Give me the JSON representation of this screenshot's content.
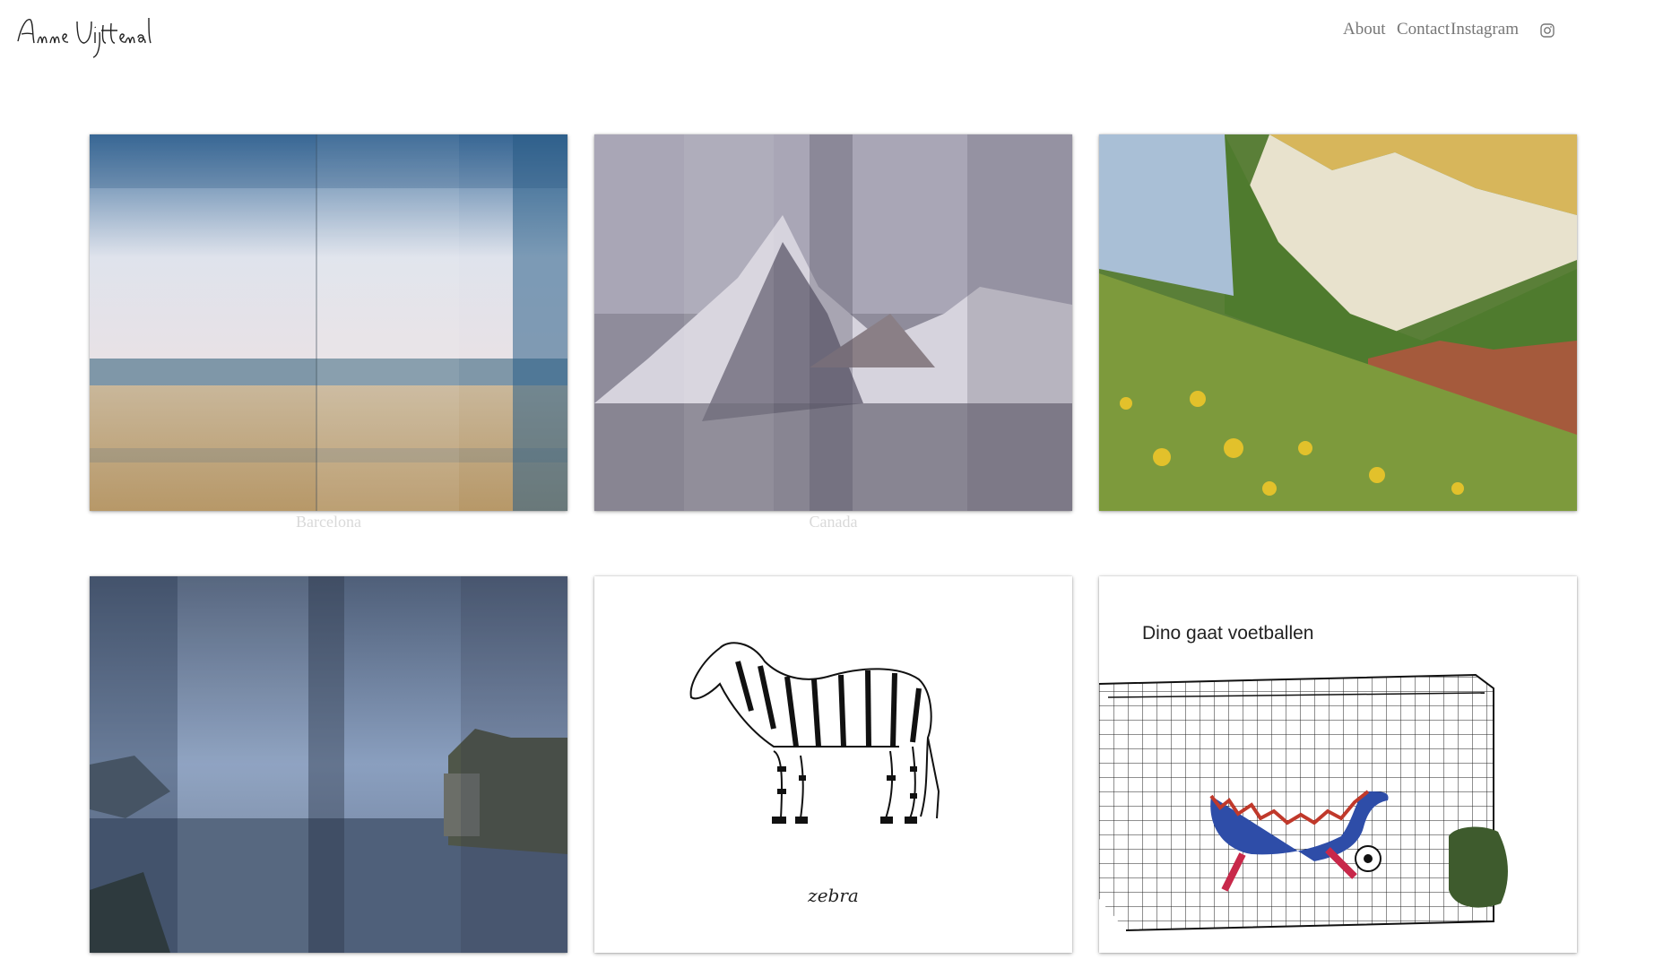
{
  "header": {
    "logo_text": "Anne Uijttewaal",
    "nav": {
      "about": "About",
      "contact": "Contact",
      "instagram": "Instagram",
      "instagram_icon": "instagram-icon"
    }
  },
  "gallery": {
    "items": [
      {
        "caption": "Barcelona",
        "image": "beach-collage"
      },
      {
        "caption": "Canada",
        "image": "mountain-collage"
      },
      {
        "caption": "",
        "image": "alpine-meadow-collage"
      },
      {
        "caption": "",
        "image": "coastal-town-collage"
      },
      {
        "caption": "",
        "image": "zebra-drawing",
        "inner_text": "zebra"
      },
      {
        "caption": "",
        "image": "dino-football-drawing",
        "inner_text": "Dino gaat voetballen"
      }
    ]
  },
  "colors": {
    "background": "#ffffff",
    "nav_text": "#777777",
    "caption_text": "#d9d9d9"
  }
}
